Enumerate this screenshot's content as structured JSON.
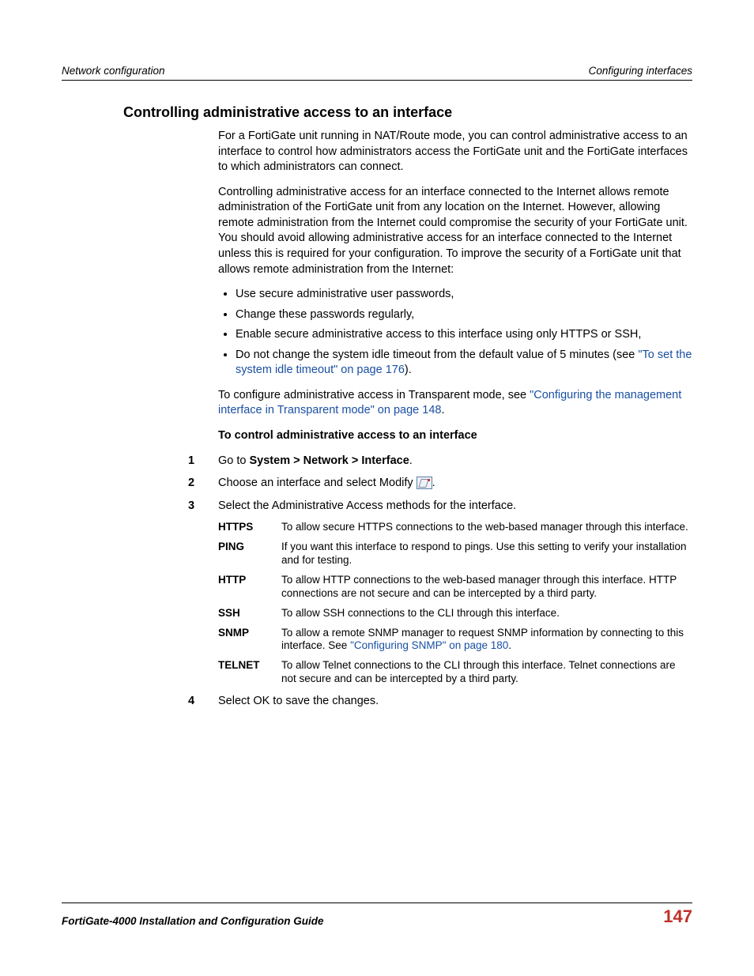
{
  "header": {
    "left": "Network configuration",
    "right": "Configuring interfaces"
  },
  "section_title": "Controlling administrative access to an interface",
  "para1": "For a FortiGate unit running in NAT/Route mode, you can control administrative access to an interface to control how administrators access the FortiGate unit and the FortiGate interfaces to which administrators can connect.",
  "para2": "Controlling administrative access for an interface connected to the Internet allows remote administration of the FortiGate unit from any location on the Internet. However, allowing remote administration from the Internet could compromise the security of your FortiGate unit. You should avoid allowing administrative access for an interface connected to the Internet unless this is required for your configuration. To improve the security of a FortiGate unit that allows remote administration from the Internet:",
  "bullets": {
    "b1": "Use secure administrative user passwords,",
    "b2": "Change these passwords regularly,",
    "b3": "Enable secure administrative access to this interface using only HTTPS or SSH,",
    "b4_pre": "Do not change the system idle timeout from the default value of 5 minutes (see ",
    "b4_link": "\"To set the system idle timeout\" on page 176",
    "b4_post": ")."
  },
  "para3_pre": "To configure administrative access in Transparent mode, see ",
  "para3_link": "\"Configuring the management interface in Transparent mode\" on page 148",
  "para3_post": ".",
  "subhead": "To control administrative access to an interface",
  "steps": {
    "s1_num": "1",
    "s1a": "Go to ",
    "s1b": "System > Network > Interface",
    "s1c": ".",
    "s2_num": "2",
    "s2a": "Choose an interface and select Modify ",
    "s2b": ".",
    "s3_num": "3",
    "s3": "Select the Administrative Access methods for the interface.",
    "s4_num": "4",
    "s4": "Select OK to save the changes."
  },
  "defs": {
    "d1_t": "HTTPS",
    "d1_d": "To allow secure HTTPS connections to the web-based manager through this interface.",
    "d2_t": "PING",
    "d2_d": "If you want this interface to respond to pings. Use this setting to verify your installation and for testing.",
    "d3_t": "HTTP",
    "d3_d": "To allow HTTP connections to the web-based manager through this interface. HTTP connections are not secure and can be intercepted by a third party.",
    "d4_t": "SSH",
    "d4_d": "To allow SSH connections to the CLI through this interface.",
    "d5_t": "SNMP",
    "d5_pre": "To allow a remote SNMP manager to request SNMP information by connecting to this interface. See ",
    "d5_link": "\"Configuring SNMP\" on page 180",
    "d5_post": ".",
    "d6_t": "TELNET",
    "d6_d": "To allow Telnet connections to the CLI through this interface. Telnet connections are not secure and can be intercepted by a third party."
  },
  "footer": {
    "left": "FortiGate-4000 Installation and Configuration Guide",
    "page": "147"
  }
}
